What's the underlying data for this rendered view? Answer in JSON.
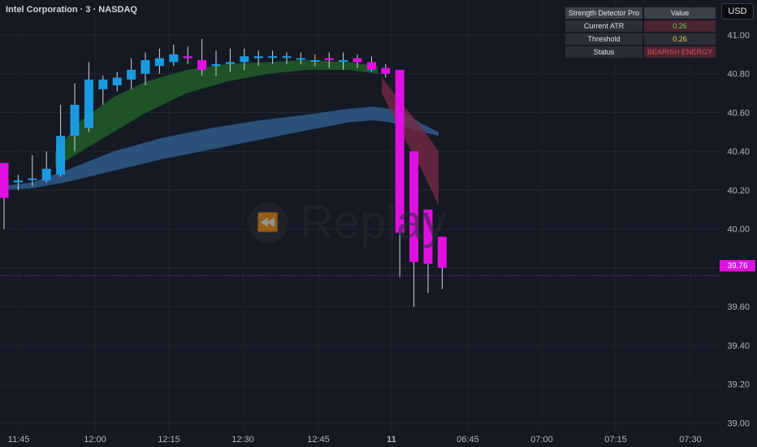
{
  "header": {
    "symbol_title": "Intel Corporation · 3 · NASDAQ",
    "currency": "USD"
  },
  "indicator_panel": {
    "col1": "Strength Detector Pro",
    "col2": "Value",
    "rows": [
      {
        "label": "Current ATR",
        "value": "0.26",
        "color": "#5ed35e"
      },
      {
        "label": "Threshold",
        "value": "0.26",
        "color": "#e6c94e"
      },
      {
        "label": "Status",
        "value": "BEARISH ENERGY",
        "color": "#e04a55"
      }
    ]
  },
  "watermark": {
    "text": "Replay"
  },
  "last_price": "39.76",
  "chart_data": {
    "type": "candlestick",
    "ylim": [
      38.96,
      41.18
    ],
    "y_ticks": [
      "41.00",
      "40.80",
      "40.60",
      "40.40",
      "40.20",
      "40.00",
      "39.80",
      "39.60",
      "39.40",
      "39.20",
      "39.00"
    ],
    "x_ticks": [
      "11:45",
      "12:00",
      "12:15",
      "12:30",
      "12:45",
      "11",
      "06:45",
      "07:00",
      "07:15",
      "07:30"
    ],
    "colors": {
      "up": "#1a9ae0",
      "down": "#e010e0",
      "green_band": "#1e5a28",
      "blue_band": "#2e5f90",
      "red_band": "#7a2a45"
    },
    "candles": [
      {
        "o": 40.34,
        "h": 40.34,
        "l": 40.0,
        "c": 40.16
      },
      {
        "o": 40.24,
        "h": 40.28,
        "l": 40.2,
        "c": 40.25
      },
      {
        "o": 40.26,
        "h": 40.38,
        "l": 40.22,
        "c": 40.26
      },
      {
        "o": 40.25,
        "h": 40.4,
        "l": 40.24,
        "c": 40.31
      },
      {
        "o": 40.28,
        "h": 40.64,
        "l": 40.27,
        "c": 40.48
      },
      {
        "o": 40.48,
        "h": 40.75,
        "l": 40.4,
        "c": 40.64
      },
      {
        "o": 40.52,
        "h": 40.86,
        "l": 40.5,
        "c": 40.77
      },
      {
        "o": 40.72,
        "h": 40.79,
        "l": 40.64,
        "c": 40.77
      },
      {
        "o": 40.74,
        "h": 40.81,
        "l": 40.71,
        "c": 40.78
      },
      {
        "o": 40.77,
        "h": 40.88,
        "l": 40.72,
        "c": 40.82
      },
      {
        "o": 40.8,
        "h": 40.91,
        "l": 40.74,
        "c": 40.87
      },
      {
        "o": 40.84,
        "h": 40.93,
        "l": 40.8,
        "c": 40.88
      },
      {
        "o": 40.86,
        "h": 40.95,
        "l": 40.84,
        "c": 40.9
      },
      {
        "o": 40.89,
        "h": 40.94,
        "l": 40.85,
        "c": 40.88
      },
      {
        "o": 40.87,
        "h": 40.98,
        "l": 40.79,
        "c": 40.82
      },
      {
        "o": 40.84,
        "h": 40.92,
        "l": 40.79,
        "c": 40.85
      },
      {
        "o": 40.85,
        "h": 40.93,
        "l": 40.81,
        "c": 40.86
      },
      {
        "o": 40.86,
        "h": 40.93,
        "l": 40.82,
        "c": 40.89
      },
      {
        "o": 40.88,
        "h": 40.92,
        "l": 40.84,
        "c": 40.89
      },
      {
        "o": 40.89,
        "h": 40.92,
        "l": 40.85,
        "c": 40.89
      },
      {
        "o": 40.89,
        "h": 40.91,
        "l": 40.85,
        "c": 40.89
      },
      {
        "o": 40.88,
        "h": 40.91,
        "l": 40.85,
        "c": 40.88
      },
      {
        "o": 40.87,
        "h": 40.9,
        "l": 40.84,
        "c": 40.87
      },
      {
        "o": 40.88,
        "h": 40.91,
        "l": 40.83,
        "c": 40.87
      },
      {
        "o": 40.87,
        "h": 40.91,
        "l": 40.82,
        "c": 40.87
      },
      {
        "o": 40.88,
        "h": 40.9,
        "l": 40.83,
        "c": 40.86
      },
      {
        "o": 40.86,
        "h": 40.89,
        "l": 40.81,
        "c": 40.82
      },
      {
        "o": 40.83,
        "h": 40.85,
        "l": 40.78,
        "c": 40.8
      },
      {
        "o": 40.82,
        "h": 40.82,
        "l": 39.75,
        "c": 39.98
      },
      {
        "o": 40.4,
        "h": 40.4,
        "l": 39.6,
        "c": 39.83
      },
      {
        "o": 40.1,
        "h": 40.1,
        "l": 39.67,
        "c": 39.82
      },
      {
        "o": 39.96,
        "h": 39.96,
        "l": 39.69,
        "c": 39.8
      }
    ]
  }
}
